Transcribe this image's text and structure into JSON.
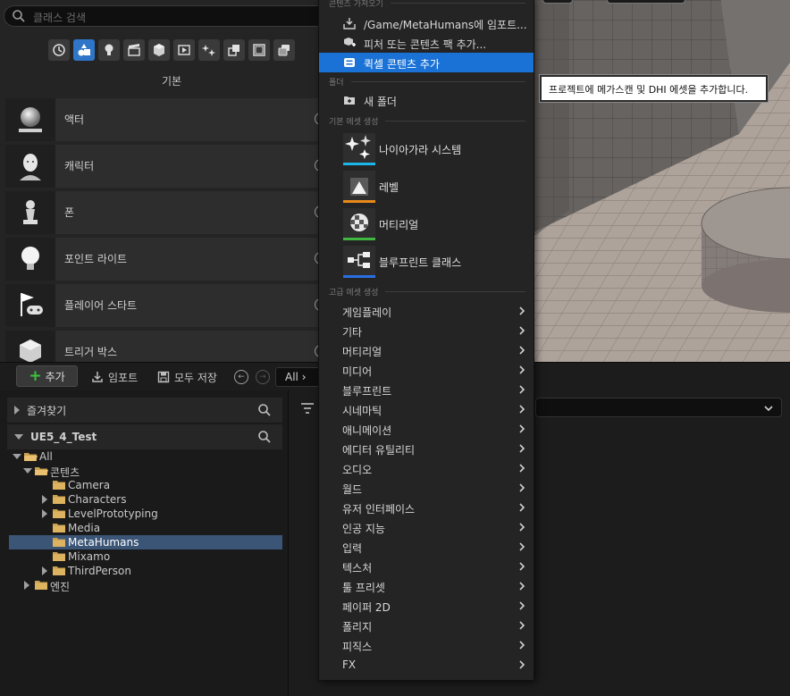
{
  "place_actors": {
    "search_placeholder": "클래스 검색",
    "category_title": "기본",
    "categories": [
      {
        "icon": "recent-clock-icon",
        "active": false
      },
      {
        "icon": "shapes-basic-icon",
        "active": true
      },
      {
        "icon": "light-bulb-icon",
        "active": false
      },
      {
        "icon": "cinematic-clapper-icon",
        "active": false
      },
      {
        "icon": "visual-effects-cube-icon",
        "active": false
      },
      {
        "icon": "volume-icon",
        "active": false
      },
      {
        "icon": "all-classes-sparkle-icon",
        "active": false
      },
      {
        "icon": "geometry-icon",
        "active": false
      },
      {
        "icon": "panel-icon",
        "active": false
      },
      {
        "icon": "stack-icon",
        "active": false
      }
    ],
    "actors": [
      {
        "label": "액터",
        "icon": "sphere-actor-icon"
      },
      {
        "label": "캐릭터",
        "icon": "character-head-icon"
      },
      {
        "label": "폰",
        "icon": "pawn-icon"
      },
      {
        "label": "포인트 라이트",
        "icon": "point-light-bulb-icon"
      },
      {
        "label": "플레이어 스타트",
        "icon": "player-start-flag-icon"
      },
      {
        "label": "트리거 박스",
        "icon": "trigger-box-icon"
      }
    ]
  },
  "content_browser": {
    "add_label": "추가",
    "import_label": "임포트",
    "save_all_label": "모두 저장",
    "path_label": "All",
    "favorites_label": "즐겨찾기",
    "project_label": "UE5_4_Test",
    "tree": [
      {
        "label": "All",
        "indent": 0,
        "expanded": true,
        "has_children": true,
        "selected": false
      },
      {
        "label": "콘텐츠",
        "indent": 1,
        "expanded": true,
        "has_children": true,
        "selected": false
      },
      {
        "label": "Camera",
        "indent": 2,
        "expanded": false,
        "has_children": false,
        "selected": false
      },
      {
        "label": "Characters",
        "indent": 2,
        "expanded": false,
        "has_children": true,
        "selected": false
      },
      {
        "label": "LevelPrototyping",
        "indent": 2,
        "expanded": false,
        "has_children": true,
        "selected": false
      },
      {
        "label": "Media",
        "indent": 2,
        "expanded": false,
        "has_children": false,
        "selected": false
      },
      {
        "label": "MetaHumans",
        "indent": 2,
        "expanded": false,
        "has_children": false,
        "selected": true
      },
      {
        "label": "Mixamo",
        "indent": 2,
        "expanded": false,
        "has_children": false,
        "selected": false
      },
      {
        "label": "ThirdPerson",
        "indent": 2,
        "expanded": false,
        "has_children": true,
        "selected": false
      },
      {
        "label": "엔진",
        "indent": 1,
        "expanded": false,
        "has_children": true,
        "selected": false
      }
    ]
  },
  "context_menu": {
    "sections": {
      "import": "콘텐츠 가져오기",
      "folder": "폴더",
      "basic": "기본 에셋 생성",
      "advanced": "고급 에셋 생성"
    },
    "import_items": [
      {
        "label": "/Game/MetaHumans에 임포트...",
        "icon": "import-arrow-icon",
        "highlighted": false
      },
      {
        "label": "피처 또는 콘텐츠 팩 추가...",
        "icon": "feature-pack-icon",
        "highlighted": false
      },
      {
        "label": "퀵셀 콘텐츠 추가",
        "icon": "quixel-bridge-icon",
        "highlighted": true
      }
    ],
    "folder_items": [
      {
        "label": "새 폴더",
        "icon": "new-folder-icon"
      }
    ],
    "basic_assets": [
      {
        "label": "나이아가라 시스템",
        "icon": "niagara-system-icon",
        "bar_color": "#1ab6e8"
      },
      {
        "label": "레벨",
        "icon": "level-icon",
        "bar_color": "#e88a1a"
      },
      {
        "label": "머티리얼",
        "icon": "material-icon",
        "bar_color": "#3fb83f"
      },
      {
        "label": "블루프린트 클래스",
        "icon": "blueprint-class-icon",
        "bar_color": "#2a6fe0"
      }
    ],
    "advanced_assets": [
      "게임플레이",
      "기타",
      "머티리얼",
      "미디어",
      "블루프린트",
      "시네마틱",
      "애니메이션",
      "에디터 유틸리티",
      "오디오",
      "월드",
      "유저 인터페이스",
      "인공 지능",
      "입력",
      "텍스처",
      "툴 프리셋",
      "페이퍼 2D",
      "폴리지",
      "피직스",
      "FX"
    ]
  },
  "tooltip": {
    "text": "프로젝트에 메가스캔 및 DHI 에셋을 추가합니다."
  },
  "colors": {
    "accent_blue": "#1a72d6",
    "selection_blue": "#3b5577",
    "add_green": "#3cc23c"
  }
}
